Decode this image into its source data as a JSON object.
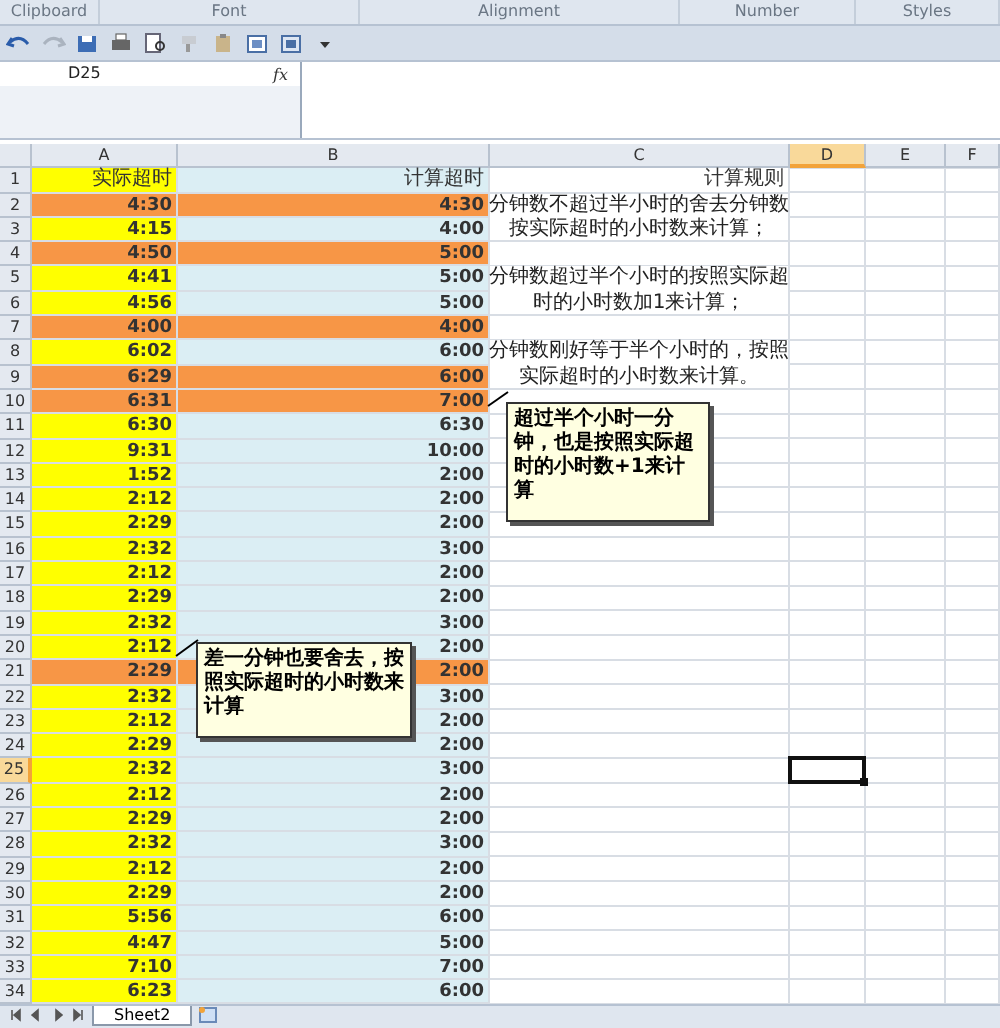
{
  "ribbon_groups": [
    "Clipboard",
    "Font",
    "Alignment",
    "Number",
    "Styles"
  ],
  "name_box": "D25",
  "function_label": "fx",
  "columns": [
    {
      "label": "A",
      "selected": false
    },
    {
      "label": "B",
      "selected": false
    },
    {
      "label": "C",
      "selected": false
    },
    {
      "label": "D",
      "selected": true
    },
    {
      "label": "E",
      "selected": false
    },
    {
      "label": "F",
      "selected": false
    }
  ],
  "header": {
    "number": "1",
    "actual": "实际超时",
    "computed": "计算超时",
    "rule": "计算规则"
  },
  "rows": [
    {
      "number": "2",
      "actual": "4:30",
      "computed": "4:30",
      "highlight": true,
      "selected": false
    },
    {
      "number": "3",
      "actual": "4:15",
      "computed": "4:00",
      "highlight": false,
      "selected": false
    },
    {
      "number": "4",
      "actual": "4:50",
      "computed": "5:00",
      "highlight": true,
      "selected": false
    },
    {
      "number": "5",
      "actual": "4:41",
      "computed": "5:00",
      "highlight": false,
      "selected": false
    },
    {
      "number": "6",
      "actual": "4:56",
      "computed": "5:00",
      "highlight": false,
      "selected": false
    },
    {
      "number": "7",
      "actual": "4:00",
      "computed": "4:00",
      "highlight": true,
      "selected": false
    },
    {
      "number": "8",
      "actual": "6:02",
      "computed": "6:00",
      "highlight": false,
      "selected": false
    },
    {
      "number": "9",
      "actual": "6:29",
      "computed": "6:00",
      "highlight": true,
      "selected": false
    },
    {
      "number": "10",
      "actual": "6:31",
      "computed": "7:00",
      "highlight": true,
      "selected": false
    },
    {
      "number": "11",
      "actual": "6:30",
      "computed": "6:30",
      "highlight": false,
      "selected": false
    },
    {
      "number": "12",
      "actual": "9:31",
      "computed": "10:00",
      "highlight": false,
      "selected": false
    },
    {
      "number": "13",
      "actual": "1:52",
      "computed": "2:00",
      "highlight": false,
      "selected": false
    },
    {
      "number": "14",
      "actual": "2:12",
      "computed": "2:00",
      "highlight": false,
      "selected": false
    },
    {
      "number": "15",
      "actual": "2:29",
      "computed": "2:00",
      "highlight": false,
      "selected": false
    },
    {
      "number": "16",
      "actual": "2:32",
      "computed": "3:00",
      "highlight": false,
      "selected": false
    },
    {
      "number": "17",
      "actual": "2:12",
      "computed": "2:00",
      "highlight": false,
      "selected": false
    },
    {
      "number": "18",
      "actual": "2:29",
      "computed": "2:00",
      "highlight": false,
      "selected": false
    },
    {
      "number": "19",
      "actual": "2:32",
      "computed": "3:00",
      "highlight": false,
      "selected": false
    },
    {
      "number": "20",
      "actual": "2:12",
      "computed": "2:00",
      "highlight": false,
      "selected": false
    },
    {
      "number": "21",
      "actual": "2:29",
      "computed": "2:00",
      "highlight": true,
      "selected": false
    },
    {
      "number": "22",
      "actual": "2:32",
      "computed": "3:00",
      "highlight": false,
      "selected": false
    },
    {
      "number": "23",
      "actual": "2:12",
      "computed": "2:00",
      "highlight": false,
      "selected": false
    },
    {
      "number": "24",
      "actual": "2:29",
      "computed": "2:00",
      "highlight": false,
      "selected": false
    },
    {
      "number": "25",
      "actual": "2:32",
      "computed": "3:00",
      "highlight": false,
      "selected": true
    },
    {
      "number": "26",
      "actual": "2:12",
      "computed": "2:00",
      "highlight": false,
      "selected": false
    },
    {
      "number": "27",
      "actual": "2:29",
      "computed": "2:00",
      "highlight": false,
      "selected": false
    },
    {
      "number": "28",
      "actual": "2:32",
      "computed": "3:00",
      "highlight": false,
      "selected": false
    },
    {
      "number": "29",
      "actual": "2:12",
      "computed": "2:00",
      "highlight": false,
      "selected": false
    },
    {
      "number": "30",
      "actual": "2:29",
      "computed": "2:00",
      "highlight": false,
      "selected": false
    },
    {
      "number": "31",
      "actual": "5:56",
      "computed": "6:00",
      "highlight": false,
      "selected": false
    },
    {
      "number": "32",
      "actual": "4:47",
      "computed": "5:00",
      "highlight": false,
      "selected": false
    },
    {
      "number": "33",
      "actual": "7:10",
      "computed": "7:00",
      "highlight": false,
      "selected": false
    },
    {
      "number": "34",
      "actual": "6:23",
      "computed": "6:00",
      "highlight": false,
      "selected": false
    }
  ],
  "rules": [
    {
      "lines": [
        "分钟数不超过半小时的舍去分钟数",
        "按实际超时的小时数来计算；"
      ]
    },
    {
      "lines": [
        "分钟数超过半个小时的按照实际超",
        "时的小时数加1来计算；"
      ]
    },
    {
      "lines": [
        "分钟数刚好等于半个小时的，按照",
        "实际超时的小时数来计算。"
      ]
    }
  ],
  "comments": [
    {
      "text": "超过半个小时一分钟，也是按照实际超时的小时数+1来计算"
    },
    {
      "text": "差一分钟也要舍去，按照实际超时的小时数来计算"
    }
  ],
  "sheet_tabs": [
    {
      "label": "Sheet2",
      "selected": true
    }
  ]
}
